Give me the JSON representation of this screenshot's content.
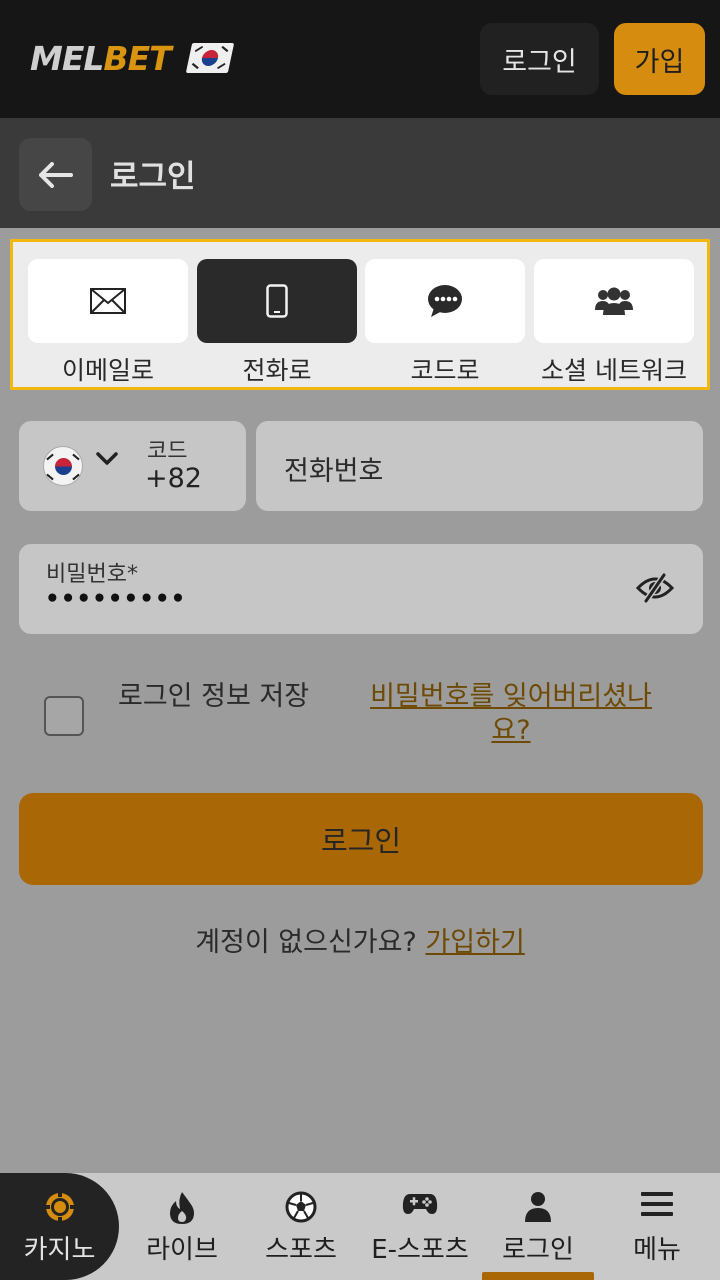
{
  "header": {
    "logo_prefix": "MEL",
    "logo_accent": "BET",
    "login_label": "로그인",
    "signup_label": "가입"
  },
  "titlebar": {
    "title": "로그인"
  },
  "methods": [
    {
      "label": "이메일로",
      "icon": "envelope-icon",
      "active": false
    },
    {
      "label": "전화로",
      "icon": "phone-icon",
      "active": true
    },
    {
      "label": "코드로",
      "icon": "chat-icon",
      "active": false
    },
    {
      "label": "소셜 네트워크",
      "icon": "users-icon",
      "active": false
    }
  ],
  "form": {
    "code_label": "코드",
    "code_value": "+82",
    "phone_placeholder": "전화번호",
    "password_label": "비밀번호*",
    "password_value": "•••••••••",
    "remember_label": "로그인 정보 저장",
    "forgot_label": "비밀번호를 잊어버리셨나요?",
    "login_button": "로그인",
    "no_account_text": "계정이 없으신가요?",
    "signup_link": "가입하기"
  },
  "bottom_nav": [
    {
      "label": "카지노",
      "icon": "casino-chip-icon"
    },
    {
      "label": "라이브",
      "icon": "flame-icon"
    },
    {
      "label": "스포츠",
      "icon": "soccer-ball-icon"
    },
    {
      "label": "E-스포츠",
      "icon": "gamepad-icon"
    },
    {
      "label": "로그인",
      "icon": "user-icon",
      "active": true
    },
    {
      "label": "메뉴",
      "icon": "hamburger-menu-icon"
    }
  ],
  "colors": {
    "accent": "#d58c0f",
    "button": "#a96705",
    "highlight_border": "#f2b711"
  }
}
